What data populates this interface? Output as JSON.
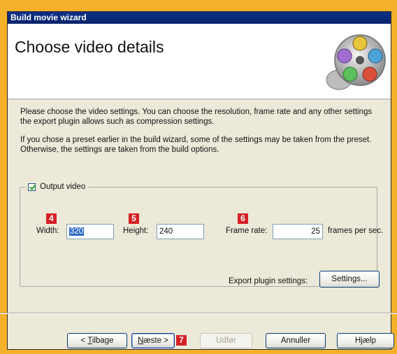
{
  "window": {
    "title": "Build movie wizard"
  },
  "header": {
    "title": "Choose video details"
  },
  "intro": {
    "paragraph1": "Please choose the video settings. You can choose the resolution, frame rate and any other settings the export plugin allows such as compression settings.",
    "paragraph2": "If you chose a preset earlier in the build wizard, some of the settings may be taken from the preset. Otherwise, the settings are taken from the build options."
  },
  "output_group": {
    "checkbox_label": "Output video",
    "checked": true,
    "width_label": "Width:",
    "width_value": "320",
    "height_label": "Height:",
    "height_value": "240",
    "framerate_label": "Frame rate:",
    "framerate_value": "25",
    "framerate_unit": "frames per sec.",
    "export_label": "Export plugin settings:",
    "settings_button": "Settings..."
  },
  "badges": {
    "width": "4",
    "height": "5",
    "framerate": "6",
    "next": "7"
  },
  "buttons": {
    "back_prefix": "< ",
    "back_access": "T",
    "back_rest": "ilbage",
    "next_access": "N",
    "next_rest": "æste >",
    "finish": "Udfør",
    "cancel": "Annuller",
    "help": "Hjælp"
  },
  "colors": {
    "background": "#F6B12A",
    "titlebar": "#0A246A",
    "badge": "#D62027",
    "dialog": "#ECE9D8"
  },
  "icons": {
    "header": "film-reel-icon"
  }
}
